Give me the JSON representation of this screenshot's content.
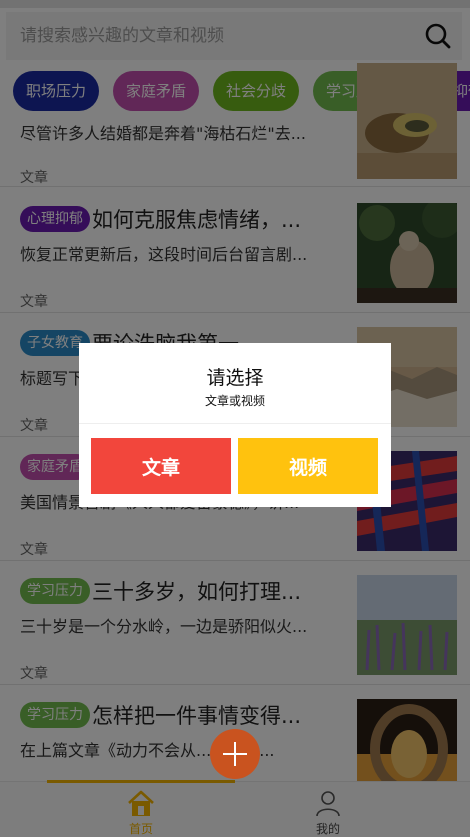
{
  "search": {
    "placeholder": "请搜索感兴趣的文章和视频"
  },
  "categories": [
    {
      "label": "职场压力",
      "color": "#1a2aa3"
    },
    {
      "label": "家庭矛盾",
      "color": "#c24fae"
    },
    {
      "label": "社会分歧",
      "color": "#6fb81f"
    },
    {
      "label": "学习压力",
      "color": "#72bd4e"
    },
    {
      "label": "心理抑郁",
      "color": "#6a1bb3"
    }
  ],
  "articles": [
    {
      "tag": "",
      "title": "",
      "summary": "尽管许多人结婚都是奔着\"海枯石烂\"去...",
      "type": "文章"
    },
    {
      "tag": "心理抑郁",
      "tag_color": "#6a1bb3",
      "title": "如何克服焦虑情绪，...",
      "summary": "恢复正常更新后，这段时间后台留言剧...",
      "type": "文章"
    },
    {
      "tag": "子女教育",
      "tag_color": "#2a8bc8",
      "title": "要论洗脑我第一",
      "summary": "标题写下来，感觉有点...；&nb...",
      "type": "文章"
    },
    {
      "tag": "家庭矛盾",
      "tag_color": "#c24fae",
      "title": "",
      "summary": "美国情景喜剧《人人都爱雷蒙德》，讲...",
      "type": "文章"
    },
    {
      "tag": "学习压力",
      "tag_color": "#72bd4e",
      "title": "三十多岁，如何打理...",
      "summary": "三十岁是一个分水岭，一边是骄阳似火...",
      "type": "文章"
    },
    {
      "tag": "学习压力",
      "tag_color": "#72bd4e",
      "title": "怎样把一件事情变得...",
      "summary": "在上篇文章《动力不会从...，而是...",
      "type": ""
    }
  ],
  "modal": {
    "title": "请选择",
    "subtitle": "文章或视频",
    "article_button": "文章",
    "video_button": "视频",
    "article_color": "#f2463c",
    "video_color": "#ffc20e"
  },
  "tabs": [
    {
      "label": "首页",
      "active": true
    },
    {
      "label": "我的",
      "active": false
    }
  ],
  "colors": {
    "accent": "#f4b400"
  }
}
